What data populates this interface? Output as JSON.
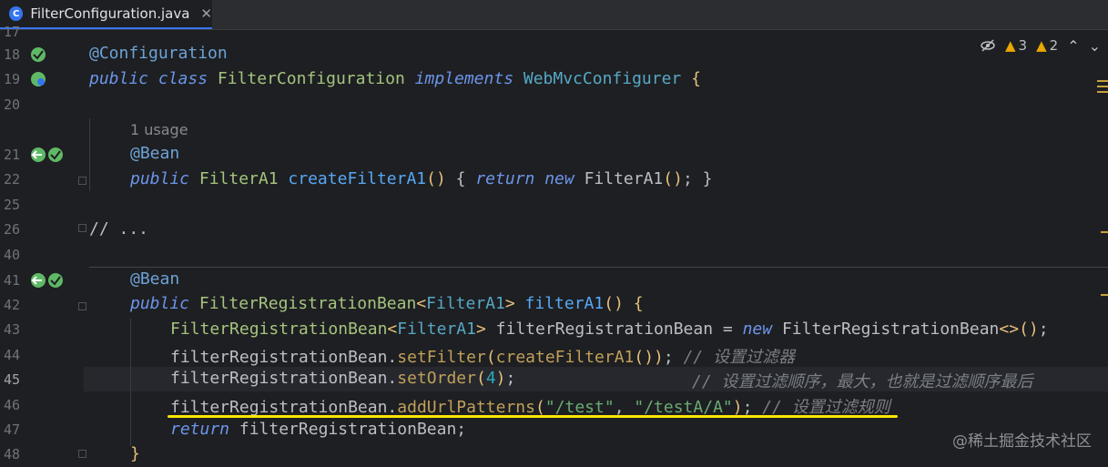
{
  "tab": {
    "icon": "C",
    "label": "FilterConfiguration.java",
    "close": "✕"
  },
  "toolbar": {
    "warn1_count": "3",
    "warn2_count": "2",
    "up_arrow": "⌃",
    "down_arrow": "⌄"
  },
  "usage_hint": "1 usage",
  "lines": {
    "l17": "17",
    "l18": "18",
    "l19": "19",
    "l20": "20",
    "l21": "21",
    "l22": "22",
    "l25": "25",
    "l26": "26",
    "l40": "40",
    "l41": "41",
    "l42": "42",
    "l43": "43",
    "l44": "44",
    "l45": "45",
    "l46": "46",
    "l47": "47",
    "l48": "48"
  },
  "code": {
    "annotation_configuration": "@Configuration",
    "kw_public": "public",
    "kw_class": "class",
    "class_name": "FilterConfiguration",
    "kw_implements": "implements",
    "iface": "WebMvcConfigurer",
    "brace_open": "{",
    "annotation_bean": "@Bean",
    "type_filtera1": "FilterA1",
    "method_create": "createFilterA1",
    "kw_return": "return",
    "kw_new": "new",
    "line22_tail": "FilterA1",
    "fold_comment": "// ...",
    "type_frb": "FilterRegistrationBean",
    "generic_filtera1": "FilterA1",
    "method_filtera1": "filterA1",
    "var_frb": "filterRegistrationBean",
    "diamond": "<>",
    "call_setfilter": "setFilter",
    "call_createfiltera1": "createFilterA1",
    "comment_44": "// 设置过滤器",
    "call_setorder": "setOrder",
    "num_4": "4",
    "comment_45": "// 设置过滤顺序，最大，也就是过滤顺序最后",
    "call_addurl": "addUrlPatterns",
    "str_test": "\"/test\"",
    "str_testa": "\"/testA/A\"",
    "comment_46": "// 设置过滤规则",
    "return_var": "filterRegistrationBean",
    "brace_close": "}"
  },
  "watermark": "@稀土掘金技术社区",
  "colors": {
    "accent": "#3574f0",
    "highlight_underline": "#ffe600",
    "warning": "#e9a700"
  }
}
